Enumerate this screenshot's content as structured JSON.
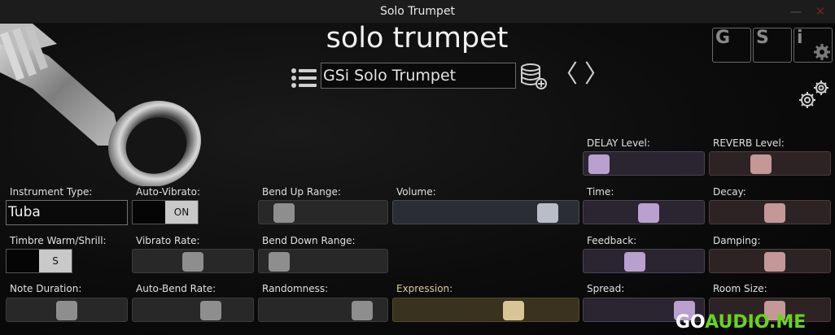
{
  "window": {
    "title": "Solo Trumpet",
    "minimize": "—",
    "close": "✕"
  },
  "app": {
    "title": "solo trumpet"
  },
  "preset": {
    "name": "GSi Solo Trumpet",
    "prev": "〈",
    "next": "〉"
  },
  "logo": {
    "letters": [
      "G",
      "S",
      "i"
    ]
  },
  "controls": {
    "instrument_type": {
      "label": "Instrument Type:",
      "value": "Tuba"
    },
    "auto_vibrato": {
      "label": "Auto-Vibrato:",
      "state": "ON"
    },
    "bend_up_range": {
      "label": "Bend Up Range:",
      "value": 0.1
    },
    "volume": {
      "label": "Volume:",
      "value": 0.9
    },
    "delay_level": {
      "label": "DELAY Level:",
      "value": 0.0
    },
    "reverb_level": {
      "label": "REVERB Level:",
      "value": 0.4
    },
    "delay_time": {
      "label": "Time:",
      "value": 0.55
    },
    "reverb_decay": {
      "label": "Decay:",
      "value": 0.55
    },
    "timbre": {
      "label": "Timbre Warm/Shrill:",
      "state": "S"
    },
    "vibrato_rate": {
      "label": "Vibrato Rate:",
      "value": 0.5
    },
    "bend_down_range": {
      "label": "Bend Down Range:",
      "value": 0.05
    },
    "feedback": {
      "label": "Feedback:",
      "value": 0.4
    },
    "damping": {
      "label": "Damping:",
      "value": 0.55
    },
    "note_duration": {
      "label": "Note Duration:",
      "value": 0.5
    },
    "auto_bend_rate": {
      "label": "Auto-Bend Rate:",
      "value": 0.7
    },
    "randomness": {
      "label": "Randomness:",
      "value": 0.9
    },
    "expression": {
      "label": "Expression:",
      "value": 0.68
    },
    "spread": {
      "label": "Spread:",
      "value": 0.95
    },
    "room_size": {
      "label": "Room Size:",
      "value": 0.55
    }
  },
  "watermark": {
    "part1": "GO",
    "part2": "AUDIO.ME"
  },
  "colors": {
    "accent_purple": "#b9a0cf",
    "accent_pink": "#c39896",
    "accent_gold": "#d7c595",
    "accent_blue": "#b9bdc8"
  }
}
